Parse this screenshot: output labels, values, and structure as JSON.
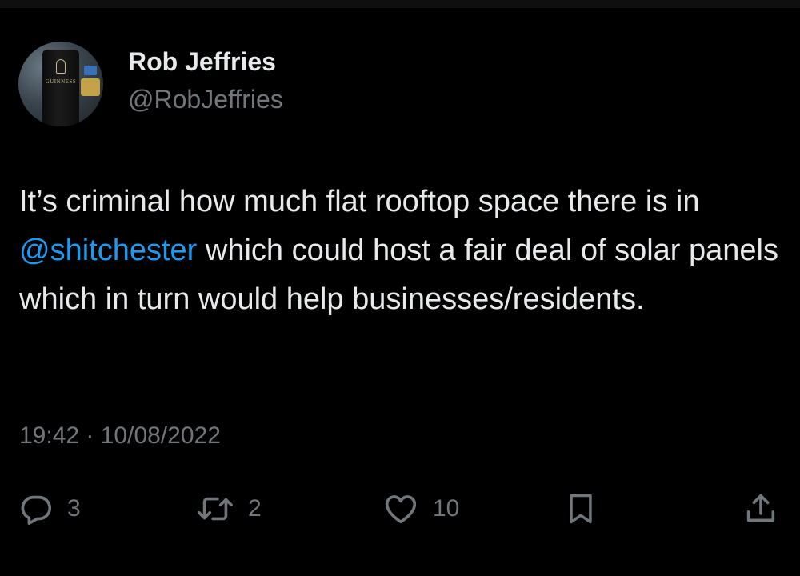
{
  "tweet": {
    "author": {
      "display_name": "Rob Jeffries",
      "handle": "@RobJeffries",
      "avatar_logo_text": "GUINNESS"
    },
    "text_parts": {
      "before_mention": "It’s criminal how much flat rooftop space there is in ",
      "mention": "@shitchester",
      "after_mention": " which could host a fair deal of solar panels which in turn would help businesses/residents."
    },
    "timestamp": "19:42 · 10/08/2022",
    "actions": {
      "reply_count": "3",
      "retweet_count": "2",
      "like_count": "10"
    }
  },
  "colors": {
    "background": "#000000",
    "primary_text": "#e7e9ea",
    "secondary_text": "#71767b",
    "link": "#1d9bf0"
  },
  "icons": {
    "reply": "reply-icon",
    "retweet": "retweet-icon",
    "like": "heart-icon",
    "bookmark": "bookmark-icon",
    "share": "share-icon"
  }
}
